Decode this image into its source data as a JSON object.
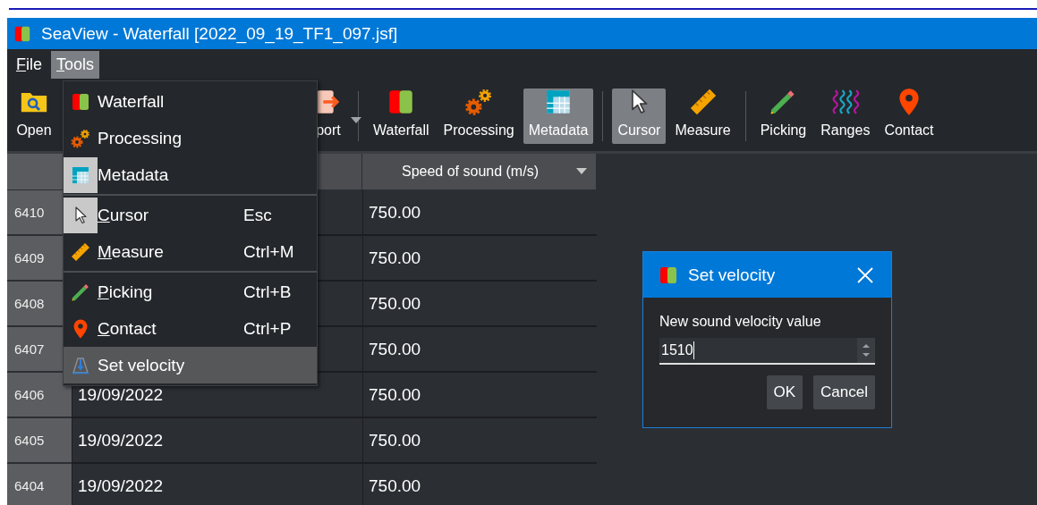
{
  "window": {
    "title": "SeaView - Waterfall [2022_09_19_TF1_097.jsf]"
  },
  "menubar": [
    {
      "label": "File",
      "mnemonic": true,
      "selected": false
    },
    {
      "label": "Tools",
      "mnemonic": true,
      "selected": true
    }
  ],
  "toolbar": [
    {
      "kind": "folder",
      "label": "Open",
      "checked": false
    },
    {
      "kind": "export",
      "label": "port",
      "checked": false,
      "dropdown": true
    },
    {
      "kind": "separator"
    },
    {
      "kind": "waterfall",
      "label": "Waterfall",
      "checked": false
    },
    {
      "kind": "gears",
      "label": "Processing",
      "checked": false
    },
    {
      "kind": "table",
      "label": "Metadata",
      "checked": true
    },
    {
      "kind": "separator"
    },
    {
      "kind": "cursor",
      "label": "Cursor",
      "checked": true
    },
    {
      "kind": "ruler",
      "label": "Measure",
      "checked": false
    },
    {
      "kind": "separator"
    },
    {
      "kind": "pencil",
      "label": "Picking",
      "checked": false
    },
    {
      "kind": "waves",
      "label": "Ranges",
      "checked": false
    },
    {
      "kind": "pin",
      "label": "Contact",
      "checked": false
    }
  ],
  "table": {
    "column_3": {
      "label": "Speed of sound (m/s)"
    },
    "rows": [
      {
        "number": "6410",
        "speed": "750.00"
      },
      {
        "number": "6409",
        "speed": "750.00"
      },
      {
        "number": "6408",
        "speed": "750.00"
      },
      {
        "number": "6407",
        "speed": "750.00"
      },
      {
        "number": "6406",
        "column_2": "19/09/2022",
        "speed": "750.00"
      },
      {
        "number": "6405",
        "column_2": "19/09/2022",
        "speed": "750.00"
      },
      {
        "number": "6404",
        "column_2": "19/09/2022",
        "speed": "750.00"
      }
    ]
  },
  "tools_menu": [
    {
      "kind": "waterfall",
      "label": "Waterfall",
      "checked": false,
      "mnemonic": false,
      "selected": false
    },
    {
      "kind": "gears",
      "label": "Processing",
      "checked": false,
      "mnemonic": false,
      "selected": false
    },
    {
      "kind": "table",
      "label": "Metadata",
      "checked": true,
      "mnemonic": false,
      "selected": false
    },
    {
      "kind": "separator"
    },
    {
      "kind": "cursor",
      "label": "Cursor",
      "shortcut": "Esc",
      "checked": true,
      "mnemonic": true,
      "selected": false
    },
    {
      "kind": "ruler",
      "label": "Measure",
      "shortcut": "Ctrl+M",
      "checked": false,
      "mnemonic": true,
      "selected": false
    },
    {
      "kind": "separator"
    },
    {
      "kind": "pencil",
      "label": "Picking",
      "shortcut": "Ctrl+B",
      "checked": false,
      "mnemonic": true,
      "selected": false
    },
    {
      "kind": "pin",
      "label": "Contact",
      "shortcut": "Ctrl+P",
      "checked": false,
      "mnemonic": true,
      "selected": false
    },
    {
      "kind": "velocity",
      "label": "Set velocity",
      "checked": false,
      "mnemonic": false,
      "selected": true
    }
  ],
  "dialog": {
    "title": "Set velocity",
    "label": "New sound velocity value",
    "value": "1510",
    "buttons": [
      "OK",
      "Cancel"
    ]
  }
}
